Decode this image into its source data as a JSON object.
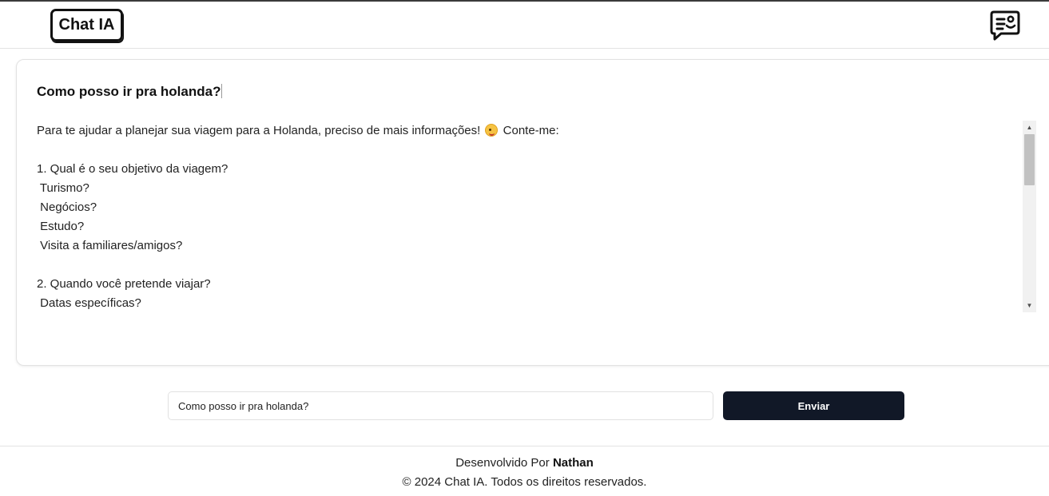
{
  "header": {
    "logo_text": "Chat IA",
    "new_chat_icon": "chat-bubble-icon"
  },
  "conversation": {
    "question": "Como posso ir pra holanda?",
    "answer_lines": [
      "Para te ajudar a planejar sua viagem para a Holanda, preciso de mais informações!",
      "Conte-me:",
      "",
      "1. Qual é o seu objetivo da viagem?",
      " Turismo?",
      " Negócios?",
      " Estudo?",
      " Visita a familiares/amigos?",
      "",
      "2. Quando você pretende viajar?",
      " Datas específicas?"
    ]
  },
  "composer": {
    "input_value": "Como posso ir pra holanda?",
    "send_label": "Enviar"
  },
  "footer": {
    "developed_by": "Desenvolvido Por",
    "author": "Nathan",
    "copyright": "© 2024 Chat IA. Todos os direitos reservados."
  },
  "colors": {
    "send_button_bg": "#111827",
    "border": "#e2e2e2"
  }
}
